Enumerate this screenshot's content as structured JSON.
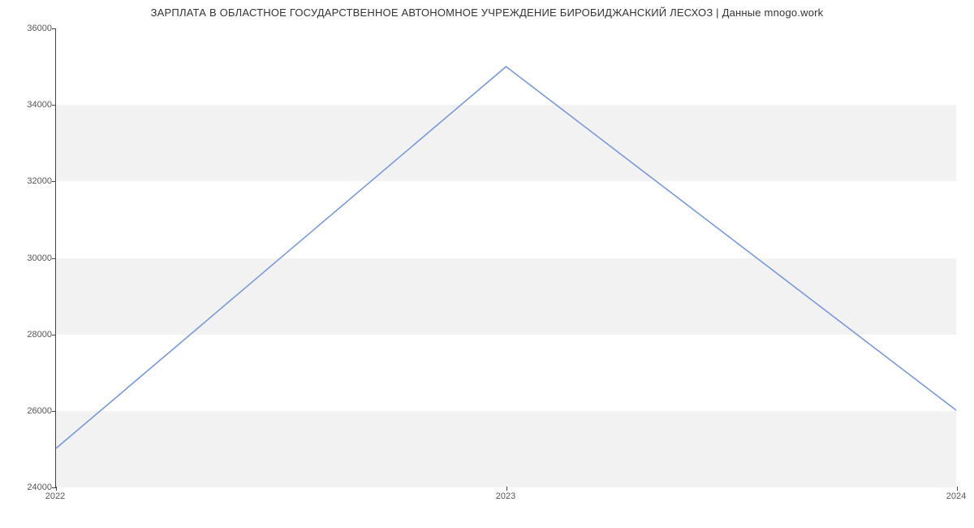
{
  "chart_data": {
    "type": "line",
    "title": "ЗАРПЛАТА В ОБЛАСТНОЕ ГОСУДАРСТВЕННОЕ АВТОНОМНОЕ УЧРЕЖДЕНИЕ БИРОБИДЖАНСКИЙ ЛЕСХОЗ | Данные mnogo.work",
    "x": [
      2022,
      2023,
      2024
    ],
    "values": [
      25000,
      35000,
      26000
    ],
    "xlabel": "",
    "ylabel": "",
    "x_ticks": [
      "2022",
      "2023",
      "2024"
    ],
    "y_ticks": [
      24000,
      26000,
      28000,
      30000,
      32000,
      34000,
      36000
    ],
    "xlim": [
      2022,
      2024
    ],
    "ylim": [
      24000,
      36000
    ],
    "grid": true
  }
}
